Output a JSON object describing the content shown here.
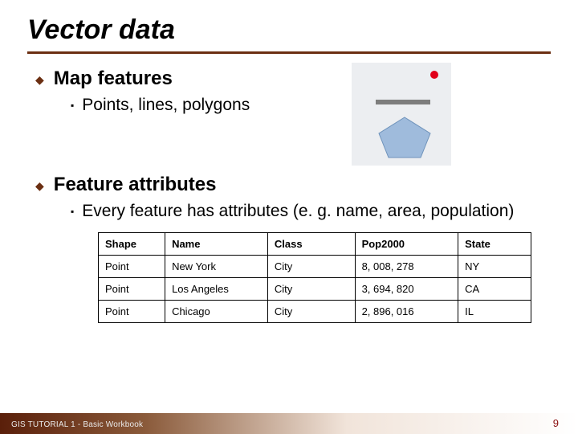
{
  "title": "Vector data",
  "sections": [
    {
      "heading": "Map features",
      "sub": [
        "Points, lines, polygons"
      ]
    },
    {
      "heading": "Feature attributes",
      "sub": [
        "Every feature has attributes (e. g. name, area, population)"
      ]
    }
  ],
  "table": {
    "headers": [
      "Shape",
      "Name",
      "Class",
      "Pop2000",
      "State"
    ],
    "rows": [
      [
        "Point",
        "New York",
        "City",
        "8, 008, 278",
        "NY"
      ],
      [
        "Point",
        "Los Angeles",
        "City",
        "3, 694, 820",
        "CA"
      ],
      [
        "Point",
        "Chicago",
        "City",
        "2, 896, 016",
        "IL"
      ]
    ]
  },
  "footer": "GIS TUTORIAL 1 - Basic Workbook",
  "page_number": "9",
  "graphic": {
    "items": [
      "point-icon",
      "line-icon",
      "polygon-icon"
    ]
  }
}
